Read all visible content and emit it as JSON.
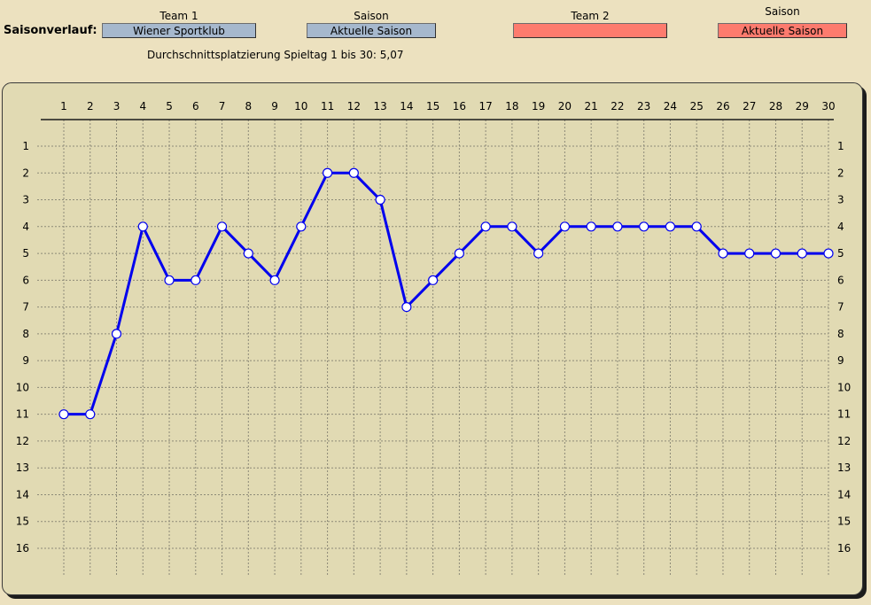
{
  "header": {
    "row_label": "Saisonverlauf:",
    "team1_title": "Team 1",
    "team1_value": "Wiener Sportklub",
    "season1_title": "Saison",
    "season1_value": "Aktuelle Saison",
    "team2_title": "Team 2",
    "team2_value": "",
    "season2_title": "Saison",
    "season2_value": "Aktuelle Saison",
    "average_text": "Durchschnittsplatzierung Spieltag 1 bis 30:  5,07"
  },
  "colors": {
    "team1_box": "#a6b8cd",
    "team2_box": "#fd7b6e",
    "series_line": "#0000ee",
    "panel_bg": "#e1dab3",
    "page_bg": "#ece1bf"
  },
  "chart_data": {
    "type": "line",
    "x": [
      1,
      2,
      3,
      4,
      5,
      6,
      7,
      8,
      9,
      10,
      11,
      12,
      13,
      14,
      15,
      16,
      17,
      18,
      19,
      20,
      21,
      22,
      23,
      24,
      25,
      26,
      27,
      28,
      29,
      30
    ],
    "series": [
      {
        "values": [
          11,
          11,
          8,
          4,
          6,
          6,
          4,
          5,
          6,
          4,
          2,
          2,
          3,
          7,
          6,
          5,
          4,
          4,
          5,
          4,
          4,
          4,
          4,
          4,
          4,
          5,
          5,
          5,
          5,
          5
        ]
      }
    ],
    "x_ticks": [
      1,
      2,
      3,
      4,
      5,
      6,
      7,
      8,
      9,
      10,
      11,
      12,
      13,
      14,
      15,
      16,
      17,
      18,
      19,
      20,
      21,
      22,
      23,
      24,
      25,
      26,
      27,
      28,
      29,
      30
    ],
    "y_ticks": [
      1,
      2,
      3,
      4,
      5,
      6,
      7,
      8,
      9,
      10,
      11,
      12,
      13,
      14,
      15,
      16
    ],
    "xlim": [
      1,
      30
    ],
    "ylim": [
      1,
      16
    ],
    "y_inverted": true,
    "grid": true,
    "x_axis_position": "top",
    "y_labels": "both-sides",
    "marker": "open-circle"
  }
}
